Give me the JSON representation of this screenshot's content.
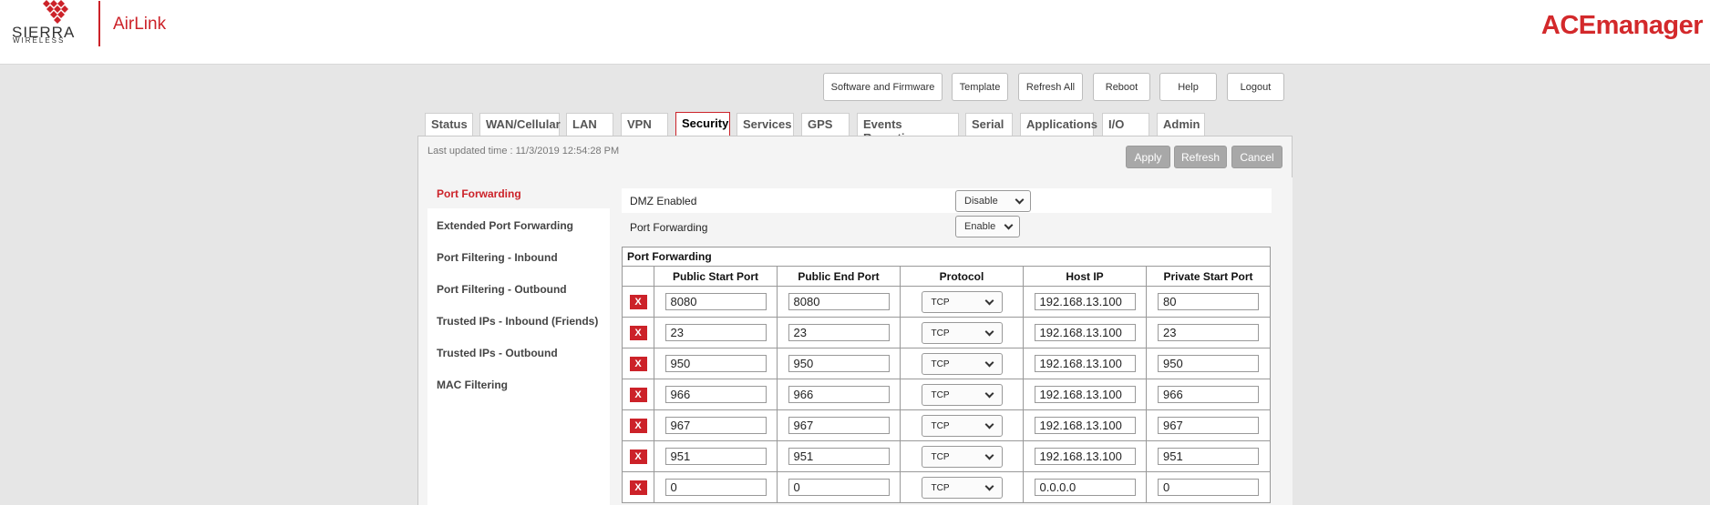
{
  "header": {
    "brand_top": "SIERRA",
    "brand_bottom": "WIRELESS",
    "airlink": "AirLink",
    "ace": "ACEmanager"
  },
  "top_buttons": [
    "Software and Firmware",
    "Template",
    "Refresh All",
    "Reboot",
    "Help",
    "Logout"
  ],
  "tabs": [
    "Status",
    "WAN/Cellular",
    "LAN",
    "VPN",
    "Security",
    "Services",
    "GPS",
    "Events Reporting",
    "Serial",
    "Applications",
    "I/O",
    "Admin"
  ],
  "active_tab": "Security",
  "last_updated": "Last updated time : 11/3/2019 12:54:28 PM",
  "actions": {
    "apply": "Apply",
    "refresh": "Refresh",
    "cancel": "Cancel"
  },
  "sidebar": {
    "items": [
      "Port Forwarding",
      "Extended Port Forwarding",
      "Port Filtering - Inbound",
      "Port Filtering - Outbound",
      "Trusted IPs - Inbound (Friends)",
      "Trusted IPs - Outbound",
      "MAC Filtering"
    ],
    "active": "Port Forwarding"
  },
  "settings": {
    "dmz": {
      "label": "DMZ Enabled",
      "value": "Disable"
    },
    "port_forwarding": {
      "label": "Port Forwarding",
      "value": "Enable"
    }
  },
  "table": {
    "caption": "Port Forwarding",
    "headers": [
      "Public Start Port",
      "Public End Port",
      "Protocol",
      "Host IP",
      "Private Start Port"
    ],
    "delete_label": "X",
    "rows": [
      {
        "pub_start": "8080",
        "pub_end": "8080",
        "protocol": "TCP",
        "host_ip": "192.168.13.100",
        "priv_start": "80"
      },
      {
        "pub_start": "23",
        "pub_end": "23",
        "protocol": "TCP",
        "host_ip": "192.168.13.100",
        "priv_start": "23"
      },
      {
        "pub_start": "950",
        "pub_end": "950",
        "protocol": "TCP",
        "host_ip": "192.168.13.100",
        "priv_start": "950"
      },
      {
        "pub_start": "966",
        "pub_end": "966",
        "protocol": "TCP",
        "host_ip": "192.168.13.100",
        "priv_start": "966"
      },
      {
        "pub_start": "967",
        "pub_end": "967",
        "protocol": "TCP",
        "host_ip": "192.168.13.100",
        "priv_start": "967"
      },
      {
        "pub_start": "951",
        "pub_end": "951",
        "protocol": "TCP",
        "host_ip": "192.168.13.100",
        "priv_start": "951"
      },
      {
        "pub_start": "0",
        "pub_end": "0",
        "protocol": "TCP",
        "host_ip": "0.0.0.0",
        "priv_start": "0"
      }
    ]
  },
  "colors": {
    "brand_red": "#cc2229",
    "ace_red": "#d3292b",
    "action_gray": "#a8a8a8",
    "page_bg": "#e6e6e6"
  }
}
